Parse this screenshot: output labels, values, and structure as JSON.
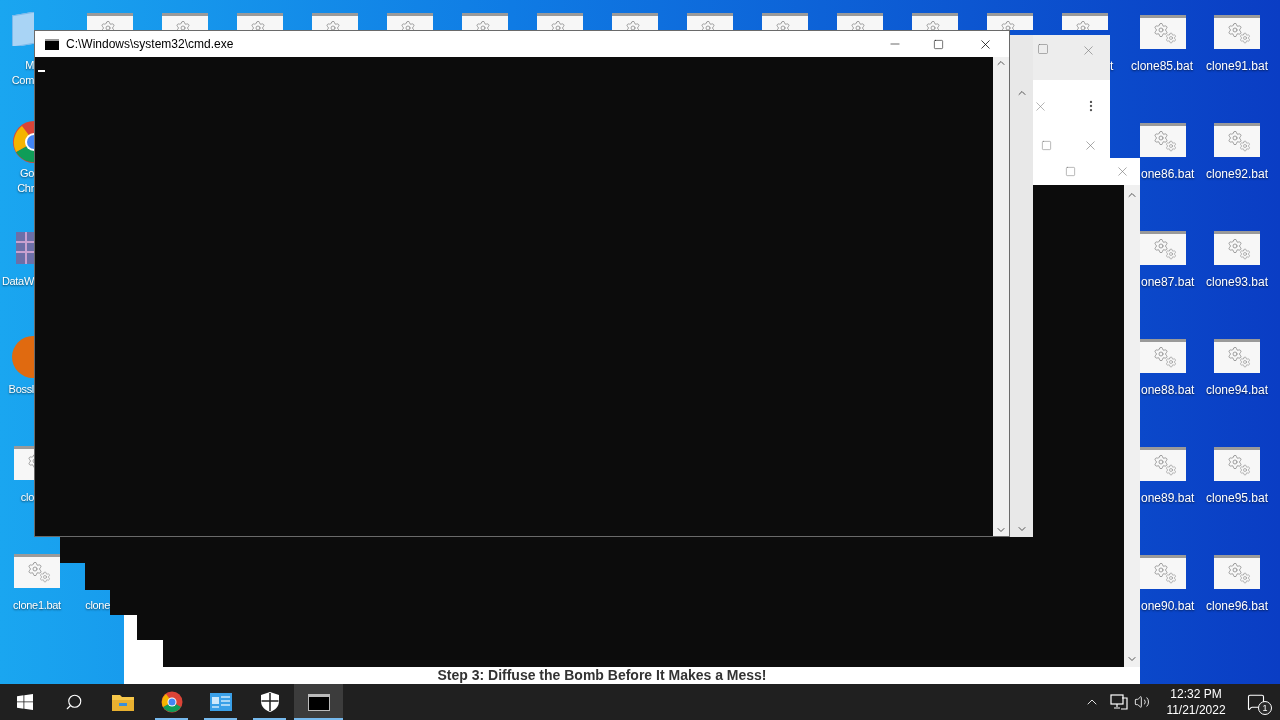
{
  "desktop": {
    "left_icons": [
      {
        "kind": "computer",
        "lines": [
          "M",
          "Com"
        ]
      },
      {
        "kind": "chrome",
        "lines": [
          "Go",
          "Chr"
        ]
      },
      {
        "kind": "grid",
        "lines": [
          "DataW"
        ]
      },
      {
        "kind": "game",
        "lines": [
          "Bossl"
        ]
      },
      {
        "kind": "batch",
        "lines": [
          "clo"
        ]
      },
      {
        "kind": "batch",
        "lines": [
          "clone1.bat"
        ]
      },
      {
        "lines": [
          "clone"
        ]
      }
    ],
    "top_icons": [
      {
        "kind": "batch"
      },
      {
        "kind": "batch"
      },
      {
        "kind": "batch"
      },
      {
        "kind": "batch"
      },
      {
        "kind": "batch"
      },
      {
        "kind": "batch"
      },
      {
        "kind": "batch"
      },
      {
        "kind": "batch"
      },
      {
        "kind": "batch"
      },
      {
        "kind": "batch"
      },
      {
        "kind": "batch"
      },
      {
        "kind": "batch"
      },
      {
        "kind": "batch"
      },
      {
        "kind": "batch",
        "label": "t"
      }
    ],
    "right_icons": [
      {
        "kind": "batch",
        "label": "clone85.bat"
      },
      {
        "kind": "batch",
        "label": "one86.bat"
      },
      {
        "kind": "batch",
        "label": "one87.bat"
      },
      {
        "kind": "batch",
        "label": "one88.bat"
      },
      {
        "kind": "batch",
        "label": "one89.bat"
      },
      {
        "kind": "batch",
        "label": "one90.bat"
      },
      {
        "kind": "batch",
        "label": "clone91.bat"
      },
      {
        "kind": "batch",
        "label": "clone92.bat"
      },
      {
        "kind": "batch",
        "label": "clone93.bat"
      },
      {
        "kind": "batch",
        "label": "clone94.bat"
      },
      {
        "kind": "batch",
        "label": "clone95.bat"
      },
      {
        "kind": "batch",
        "label": "clone96.bat"
      }
    ]
  },
  "web_page": {
    "heading": "Step 3: Diffuse the Bomb Before It Makes a Mess!"
  },
  "console_window": {
    "title": "C:\\Windows\\system32\\cmd.exe"
  },
  "taskbar": {
    "apps": [
      {
        "kind": "start",
        "selected": false,
        "running": false
      },
      {
        "kind": "search",
        "selected": false,
        "running": false
      },
      {
        "kind": "explorer",
        "selected": false,
        "running": false
      },
      {
        "kind": "chrome",
        "selected": false,
        "running": true
      },
      {
        "kind": "app",
        "selected": false,
        "running": true
      },
      {
        "kind": "security",
        "selected": false,
        "running": true
      },
      {
        "kind": "console",
        "selected": true,
        "running": true
      }
    ],
    "clock": {
      "time": "12:32 PM",
      "date": "11/21/2022"
    },
    "notifications": {
      "count": "1"
    }
  }
}
